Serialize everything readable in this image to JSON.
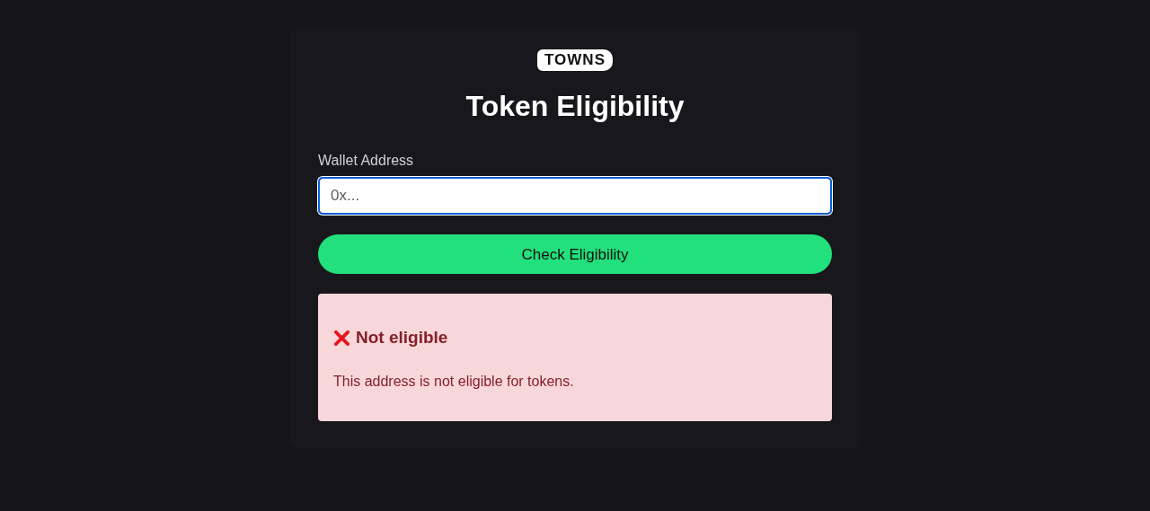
{
  "logo": {
    "text": "TOWNS"
  },
  "title": "Token Eligibility",
  "wallet_field": {
    "label": "Wallet Address",
    "placeholder": "0x...",
    "focused": true
  },
  "check_button": {
    "label": "Check Eligibility"
  },
  "result": {
    "kind": "error",
    "heading": "Not eligible",
    "message": "This address is not eligible for tokens."
  }
}
